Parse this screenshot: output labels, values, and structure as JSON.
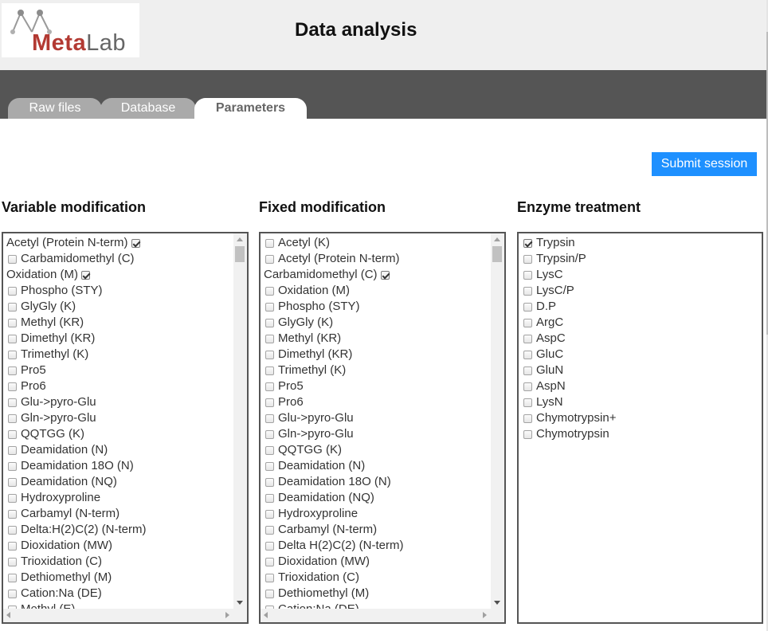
{
  "header": {
    "logo_meta": "Meta",
    "logo_lab": "Lab",
    "title": "Data analysis"
  },
  "tabs": [
    {
      "label": "Raw files",
      "active": false
    },
    {
      "label": "Database",
      "active": false
    },
    {
      "label": "Parameters",
      "active": true
    }
  ],
  "submit_label": "Submit session",
  "colors": {
    "accent": "#1e90ff",
    "logo_red": "#b33a33",
    "tabbar": "#555555",
    "tab_inactive": "#aaaaaa"
  },
  "variable_modification": {
    "title": "Variable modification",
    "items": [
      {
        "label": "Acetyl (Protein N-term)",
        "checked": true
      },
      {
        "label": "Carbamidomethyl (C)",
        "checked": false
      },
      {
        "label": "Oxidation (M)",
        "checked": true
      },
      {
        "label": "Phospho (STY)",
        "checked": false
      },
      {
        "label": "GlyGly (K)",
        "checked": false
      },
      {
        "label": "Methyl (KR)",
        "checked": false
      },
      {
        "label": "Dimethyl (KR)",
        "checked": false
      },
      {
        "label": "Trimethyl (K)",
        "checked": false
      },
      {
        "label": "Pro5",
        "checked": false
      },
      {
        "label": "Pro6",
        "checked": false
      },
      {
        "label": "Glu->pyro-Glu",
        "checked": false
      },
      {
        "label": "Gln->pyro-Glu",
        "checked": false
      },
      {
        "label": "QQTGG (K)",
        "checked": false
      },
      {
        "label": "Deamidation (N)",
        "checked": false
      },
      {
        "label": "Deamidation 18O (N)",
        "checked": false
      },
      {
        "label": "Deamidation (NQ)",
        "checked": false
      },
      {
        "label": "Hydroxyproline",
        "checked": false
      },
      {
        "label": "Carbamyl (N-term)",
        "checked": false
      },
      {
        "label": "Delta:H(2)C(2) (N-term)",
        "checked": false
      },
      {
        "label": "Dioxidation (MW)",
        "checked": false
      },
      {
        "label": "Trioxidation (C)",
        "checked": false
      },
      {
        "label": "Dethiomethyl (M)",
        "checked": false
      },
      {
        "label": "Cation:Na (DE)",
        "checked": false
      },
      {
        "label": "Methyl (E)",
        "checked": false
      }
    ]
  },
  "fixed_modification": {
    "title": "Fixed modification",
    "items": [
      {
        "label": "Acetyl (K)",
        "checked": false
      },
      {
        "label": "Acetyl (Protein N-term)",
        "checked": false
      },
      {
        "label": "Carbamidomethyl (C)",
        "checked": true
      },
      {
        "label": "Oxidation (M)",
        "checked": false
      },
      {
        "label": "Phospho (STY)",
        "checked": false
      },
      {
        "label": "GlyGly (K)",
        "checked": false
      },
      {
        "label": "Methyl (KR)",
        "checked": false
      },
      {
        "label": "Dimethyl (KR)",
        "checked": false
      },
      {
        "label": "Trimethyl (K)",
        "checked": false
      },
      {
        "label": "Pro5",
        "checked": false
      },
      {
        "label": "Pro6",
        "checked": false
      },
      {
        "label": "Glu->pyro-Glu",
        "checked": false
      },
      {
        "label": "Gln->pyro-Glu",
        "checked": false
      },
      {
        "label": "QQTGG (K)",
        "checked": false
      },
      {
        "label": "Deamidation (N)",
        "checked": false
      },
      {
        "label": "Deamidation 18O (N)",
        "checked": false
      },
      {
        "label": "Deamidation (NQ)",
        "checked": false
      },
      {
        "label": "Hydroxyproline",
        "checked": false
      },
      {
        "label": "Carbamyl (N-term)",
        "checked": false
      },
      {
        "label": "Delta H(2)C(2) (N-term)",
        "checked": false
      },
      {
        "label": "Dioxidation (MW)",
        "checked": false
      },
      {
        "label": "Trioxidation (C)",
        "checked": false
      },
      {
        "label": "Dethiomethyl (M)",
        "checked": false
      },
      {
        "label": "Cation:Na (DE)",
        "checked": false
      }
    ]
  },
  "enzyme_treatment": {
    "title": "Enzyme treatment",
    "items": [
      {
        "label": "Trypsin",
        "checked": true
      },
      {
        "label": "Trypsin/P",
        "checked": false
      },
      {
        "label": "LysC",
        "checked": false
      },
      {
        "label": "LysC/P",
        "checked": false
      },
      {
        "label": "D.P",
        "checked": false
      },
      {
        "label": "ArgC",
        "checked": false
      },
      {
        "label": "AspC",
        "checked": false
      },
      {
        "label": "GluC",
        "checked": false
      },
      {
        "label": "GluN",
        "checked": false
      },
      {
        "label": "AspN",
        "checked": false
      },
      {
        "label": "LysN",
        "checked": false
      },
      {
        "label": "Chymotrypsin+",
        "checked": false
      },
      {
        "label": "Chymotrypsin",
        "checked": false
      }
    ]
  }
}
